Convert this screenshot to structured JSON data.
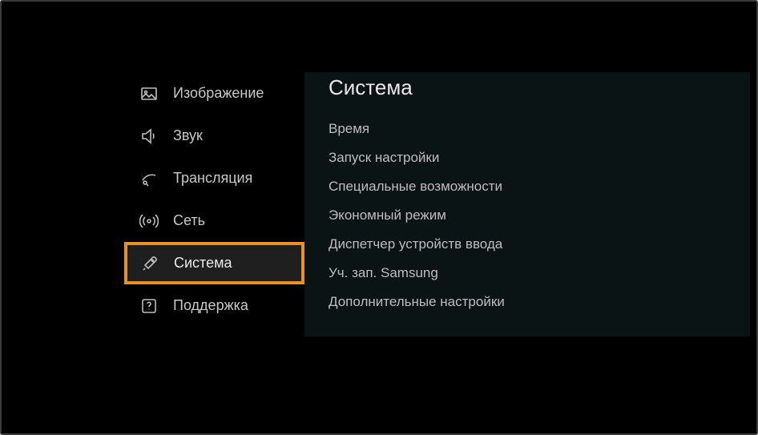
{
  "sidebar": {
    "items": [
      {
        "label": "Изображение",
        "icon": "image-icon",
        "selected": false
      },
      {
        "label": "Звук",
        "icon": "speaker-icon",
        "selected": false
      },
      {
        "label": "Трансляция",
        "icon": "satellite-icon",
        "selected": false
      },
      {
        "label": "Сеть",
        "icon": "antenna-icon",
        "selected": false
      },
      {
        "label": "Система",
        "icon": "tools-icon",
        "selected": true
      },
      {
        "label": "Поддержка",
        "icon": "support-icon",
        "selected": false
      }
    ]
  },
  "content": {
    "title": "Система",
    "items": [
      "Время",
      "Запуск настройки",
      "Специальные возможности",
      "Экономный режим",
      "Диспетчер устройств ввода",
      "Уч. зап. Samsung",
      "Дополнительные настройки"
    ]
  }
}
